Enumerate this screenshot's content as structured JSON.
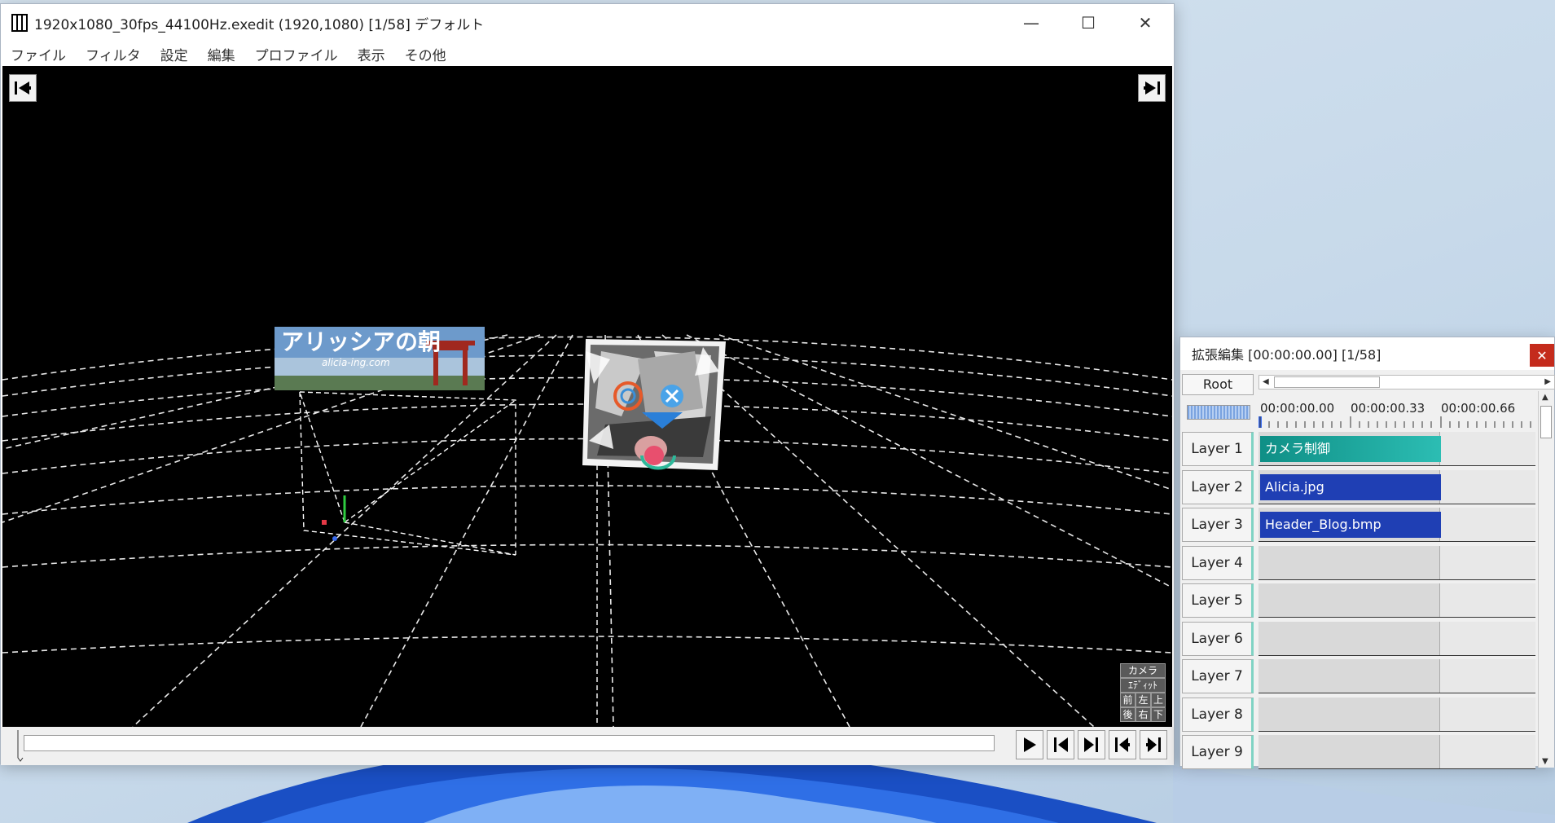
{
  "main_window": {
    "title": "1920x1080_30fps_44100Hz.exedit (1920,1080)  [1/58]  デフォルト",
    "controls": {
      "minimize": "—",
      "maximize": "☐",
      "close": "✕"
    },
    "menu": [
      "ファイル",
      "フィルタ",
      "設定",
      "編集",
      "プロファイル",
      "表示",
      "その他"
    ]
  },
  "preview": {
    "banner_title": "アリッシアの朝",
    "banner_url": "alicia-ing.com",
    "camera_panel": {
      "row1": "カメラ",
      "row2": "ｴﾃﾞｨｯﾄ",
      "row3": [
        "前",
        "左",
        "上"
      ],
      "row4": [
        "後",
        "右",
        "下"
      ]
    }
  },
  "ext_window": {
    "title": "拡張編集 [00:00:00.00] [1/58]",
    "close": "✕",
    "root_button": "Root",
    "ruler_times": [
      "00:00:00.00",
      "00:00:00.33",
      "00:00:00.66"
    ],
    "layers": [
      {
        "label": "Layer  1",
        "clip": "カメラ制御",
        "clip_type": "camera"
      },
      {
        "label": "Layer  2",
        "clip": "Alicia.jpg",
        "clip_type": "media"
      },
      {
        "label": "Layer  3",
        "clip": "Header_Blog.bmp",
        "clip_type": "media"
      },
      {
        "label": "Layer  4",
        "clip": null
      },
      {
        "label": "Layer  5",
        "clip": null
      },
      {
        "label": "Layer  6",
        "clip": null
      },
      {
        "label": "Layer  7",
        "clip": null
      },
      {
        "label": "Layer  8",
        "clip": null
      },
      {
        "label": "Layer  9",
        "clip": null
      }
    ]
  },
  "colors": {
    "camera_clip": "#1aa79e",
    "media_clip": "#1f3fb4",
    "close_button": "#c42b1c"
  }
}
